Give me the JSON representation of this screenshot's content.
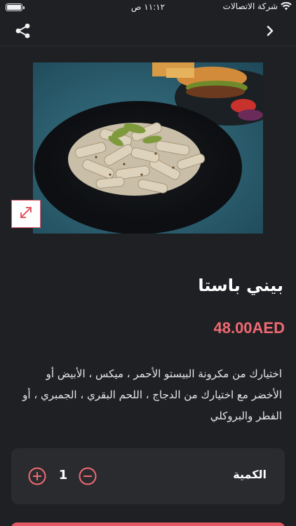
{
  "status_bar": {
    "time": "١١:١٢ ص",
    "carrier": "شركة الاتصالات",
    "icons": [
      "battery-icon",
      "wifi-icon"
    ]
  },
  "nav": {
    "icons": [
      "share-icon",
      "chevron-right-icon"
    ]
  },
  "product": {
    "title": "بيني باستا",
    "price": "48.00AED",
    "description": "اختيارك من مكرونة البيستو الأحمر ، ميكس ، الأبيض أو الأخضر مع اختيارك من الدجاج ، اللحم البقري ، الجمبري ، أو الفطر والبروكلي",
    "image_icon": "expand-icon"
  },
  "quantity": {
    "label": "الكمية",
    "value": "1",
    "icons": [
      "plus-circle-icon",
      "minus-circle-icon"
    ]
  },
  "colors": {
    "background": "#1f2024",
    "card": "#2a2b2f",
    "accent": "#e35a66",
    "price": "#f06a72"
  }
}
